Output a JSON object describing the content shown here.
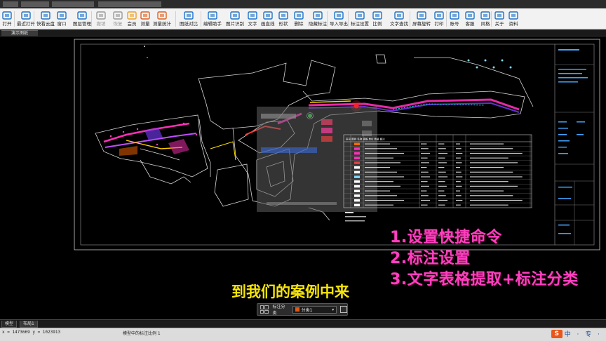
{
  "toolbar": {
    "buttons": [
      {
        "label": "打开",
        "icon": "folder-open-icon"
      },
      {
        "label": "最近打开",
        "icon": "recent-files-icon"
      },
      {
        "label": "快看云盘",
        "icon": "cloud-drive-icon"
      },
      {
        "label": "窗口",
        "icon": "window-icon"
      },
      {
        "label": "图层管理",
        "icon": "layers-icon"
      },
      {
        "label": "撤销",
        "icon": "undo-icon"
      },
      {
        "label": "恢复",
        "icon": "redo-icon"
      },
      {
        "label": "会员",
        "icon": "vip-icon"
      },
      {
        "label": "测量",
        "icon": "measure-icon"
      },
      {
        "label": "测量统计",
        "icon": "measure-stats-icon"
      },
      {
        "label": "图纸对比",
        "icon": "compare-icon"
      },
      {
        "label": "编辑助手",
        "icon": "edit-assistant-icon"
      },
      {
        "label": "图片识别",
        "icon": "image-recognition-icon"
      },
      {
        "label": "文字",
        "icon": "text-icon"
      },
      {
        "label": "画直线",
        "icon": "line-icon"
      },
      {
        "label": "形状",
        "icon": "shape-icon"
      },
      {
        "label": "删除",
        "icon": "eraser-icon"
      },
      {
        "label": "隐藏标注",
        "icon": "hide-annotation-icon"
      },
      {
        "label": "导入导出",
        "icon": "import-export-icon"
      },
      {
        "label": "标注设置",
        "icon": "annotation-settings-icon"
      },
      {
        "label": "比例",
        "icon": "scale-icon"
      },
      {
        "label": "文字查找",
        "icon": "text-search-icon"
      },
      {
        "label": "屏幕旋转",
        "icon": "rotate-icon"
      },
      {
        "label": "打印",
        "icon": "print-icon"
      },
      {
        "label": "账号",
        "icon": "account-icon"
      },
      {
        "label": "客服",
        "icon": "support-icon"
      },
      {
        "label": "风格",
        "icon": "style-icon"
      },
      {
        "label": "关于",
        "icon": "about-icon"
      },
      {
        "label": "资料",
        "icon": "docs-icon"
      }
    ]
  },
  "document_tab": "演示图纸",
  "overlay": {
    "steps": [
      "1.设置快捷命令",
      "2.标注设置",
      "3.文字表格提取+标注分类"
    ],
    "subtitle": "到我们的案例中来"
  },
  "annotation_bar": {
    "label": "标注分类",
    "selected": "分类1",
    "swatch_color": "#e05a12"
  },
  "drawing": {
    "title_block_label": "总平面布置图",
    "legend_header": [
      "序号",
      "图例",
      "名称",
      "规格",
      "单位",
      "数量",
      "备注"
    ]
  },
  "model_tabs": [
    "模型",
    "布局1"
  ],
  "status": {
    "coords": "x = 1473669  y = 1023913",
    "message": "模型中的标注比例 1"
  },
  "brand": {
    "logo": "S",
    "text": "中 · 专 ·"
  }
}
